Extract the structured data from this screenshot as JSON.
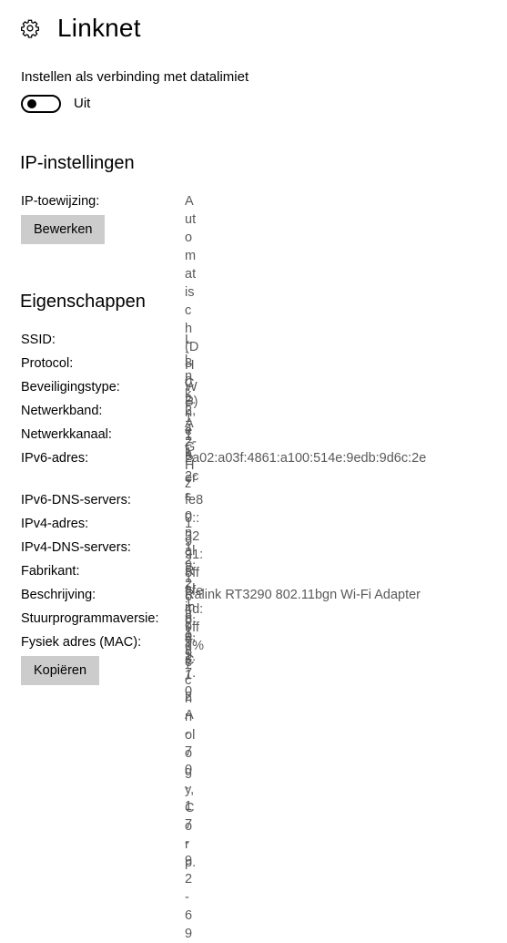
{
  "header": {
    "title": "Linknet",
    "icon": "gear-icon"
  },
  "metered": {
    "label": "Instellen als verbinding met datalimiet",
    "toggle_state": "Uit",
    "toggle_on": false
  },
  "ip_settings": {
    "title": "IP-instellingen",
    "assignment_label": "IP-toewijzing:",
    "assignment_value": "Automatisch (DHCP)",
    "edit_button": "Bewerken"
  },
  "properties": {
    "title": "Eigenschappen",
    "rows": [
      {
        "key": "SSID:",
        "value": "Linknet"
      },
      {
        "key": "Protocol:",
        "value": "802.11n"
      },
      {
        "key": "Beveiligingstype:",
        "value": "WPA2-Personal"
      },
      {
        "key": "Netwerkband:",
        "value": "2,4 GHz"
      },
      {
        "key": "Netwerkkanaal:",
        "value": "11"
      },
      {
        "key": "IPv6-adres:",
        "value": "2a02:a03f:4861:a100:514e:9edb:9d6c:2e2c"
      },
      {
        "key": "IPv6-DNS-servers:",
        "value": "fe80::3291:8fff:fe4d:9ffd%7"
      },
      {
        "key": "IPv4-adres:",
        "value": "192.168.1.8"
      },
      {
        "key": "IPv4-DNS-servers:",
        "value": "192.168.1.1"
      },
      {
        "key": "Fabrikant:",
        "value": "Ralink Technology, Corp."
      },
      {
        "key": "Beschrijving:",
        "value": "Ralink RT3290 802.11bgn Wi-Fi Adapter"
      },
      {
        "key": "Stuurprogrammaversie:",
        "value": "5.0.57.0"
      },
      {
        "key": "Fysiek adres (MAC):",
        "value": "9C-2A-70-17-92-69"
      }
    ],
    "copy_button": "Kopiëren"
  }
}
